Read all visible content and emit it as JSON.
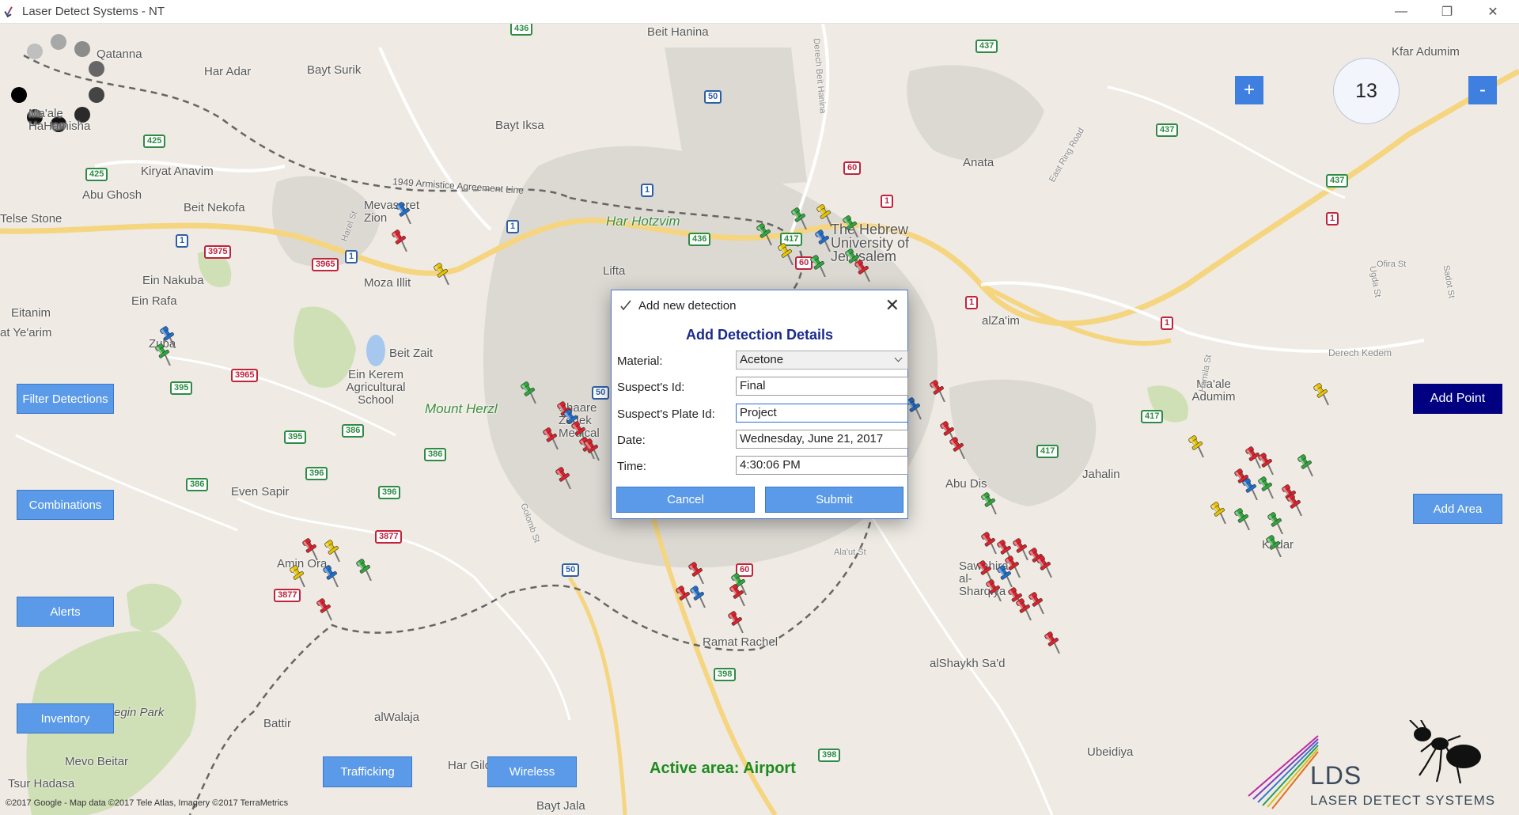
{
  "window": {
    "title": "Laser Detect Systems - NT",
    "minimize": "—",
    "restore": "❐",
    "close": "✕"
  },
  "map": {
    "zoom_in": "+",
    "zoom_out": "-",
    "zoom_level": "13",
    "places": [
      "Beit Hanina",
      "Kfar Adumim",
      "Qatanna",
      "Har Adar",
      "Bayt Surik",
      "Ma'ale HaHamisha",
      "Bayt Iksa",
      "Kiryat Anavim",
      "Anata",
      "Abu Ghosh",
      "Beit Nekofa",
      "Telse Stone",
      "Mevaseret Zion",
      "1949 Armistice Agreement Line",
      "Har Hotzvim",
      "The Hebrew University of Jerusalem",
      "Moza Illit",
      "Lifta",
      "alZa'im",
      "Ein Nakuba",
      "Ein Rafa",
      "at Ye'arim",
      "Zuba",
      "Beit Zait",
      "Ein Kerem Agricultural School",
      "Mount Herzl",
      "Shaare Zedek Medical",
      "Ma'ale Adumim",
      "Derech Kedem",
      "Abu Dis",
      "Jahalin",
      "Even Sapir",
      "Amin Ora",
      "Sawahira al-Sharqiya",
      "alShaykh Sa'd",
      "Ramat Rachel",
      "Kedar",
      "egin Park",
      "Battir",
      "alWalaja",
      "Mevo Beitar",
      "Har Gilo",
      "Tsur Hadasa",
      "Bayt Jala",
      "Ubeidiya",
      "Eitanim",
      "Golomb St",
      "Ala'ut St",
      "East Ring Road",
      "Derech Beit Hanina",
      "Harel St",
      "Ofira St",
      "Sadot St",
      "Ugda St",
      "Hamila St"
    ],
    "copyright": "©2017 Google - Map data ©2017 Tele Atlas, Imagery ©2017 TerraMetrics",
    "active_area": "Active area: Airport"
  },
  "sidebar": {
    "filter": "Filter Detections",
    "combinations": "Combinations",
    "alerts": "Alerts",
    "inventory": "Inventory",
    "trafficking": "Trafficking",
    "wireless": "Wireless",
    "add_point": "Add Point",
    "add_area": "Add Area"
  },
  "logo": {
    "short": "LDS",
    "full": "LASER DETECT SYSTEMS"
  },
  "dialog": {
    "title": "Add new detection",
    "heading": "Add Detection Details",
    "material_label": "Material:",
    "material_value": "Acetone",
    "suspect_label": "Suspect's Id:",
    "suspect_value": "Final",
    "plate_label": "Suspect's Plate Id:",
    "plate_value": "Project",
    "date_label": "Date:",
    "date_value": "Wednesday, June 21, 2017",
    "time_label": "Time:",
    "time_value": "4:30:06 PM",
    "cancel": "Cancel",
    "submit": "Submit"
  },
  "colors": {
    "accent": "#5b9ae8",
    "dark_button": "#000080",
    "pin_red": "#e0202a",
    "pin_green": "#2ea83a",
    "pin_blue": "#1f6fd0",
    "pin_yellow": "#e8c400",
    "active_area": "#1f8a1f"
  }
}
